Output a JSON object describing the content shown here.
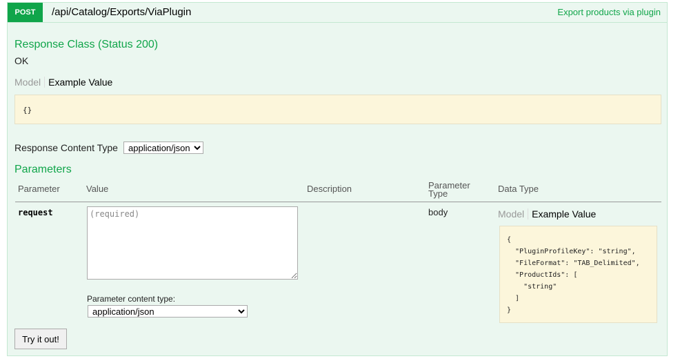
{
  "operation": {
    "method": "POST",
    "path": "/api/Catalog/Exports/ViaPlugin",
    "summary": "Export products via plugin"
  },
  "response": {
    "class_title": "Response Class (Status 200)",
    "status_text": "OK",
    "tab_model": "Model",
    "tab_example": "Example Value",
    "example": "{}",
    "content_type_label": "Response Content Type",
    "content_type_value": "application/json"
  },
  "parameters": {
    "title": "Parameters",
    "headers": {
      "parameter": "Parameter",
      "value": "Value",
      "description": "Description",
      "parameter_type_line1": "Parameter",
      "parameter_type_line2": "Type",
      "data_type": "Data Type"
    },
    "rows": [
      {
        "name": "request",
        "placeholder": "(required)",
        "description": "",
        "param_type": "body",
        "content_type_label": "Parameter content type:",
        "content_type_value": "application/json",
        "data_type_tab_model": "Model",
        "data_type_tab_example": "Example Value",
        "example": "{\n  \"PluginProfileKey\": \"string\",\n  \"FileFormat\": \"TAB_Delimited\",\n  \"ProductIds\": [\n    \"string\"\n  ]\n}"
      }
    ]
  },
  "actions": {
    "try_label": "Try it out!"
  },
  "colors": {
    "accent": "#10a54a",
    "panel_bg": "#ebf7f0",
    "panel_border": "#c3e8d1",
    "snippet_bg": "#fcf6db"
  }
}
